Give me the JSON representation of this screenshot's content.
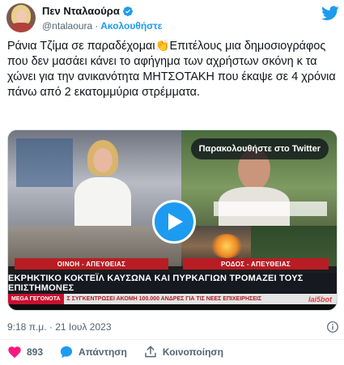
{
  "author": {
    "display_name": "Πεν Νταλαούρα",
    "handle": "@ntalaoura",
    "separator": "·",
    "follow_label": "Ακολουθήστε"
  },
  "tweet": {
    "text": "Ράνια Τζίμα σε παραδέχομαι👏Επιτέλους μια δημοσιογράφος που δεν μασάει κάνει το αφήγημα των αχρήστων σκόνη κ τα χώνει για την ανικανότητα ΜΗΤΣΟΤΑΚΗ που έκαψε σε 4 χρόνια πάνω από 2 εκατομμύρια στρέμματα.",
    "timestamp": "9:18 π.μ. · 21 Ιουλ 2023"
  },
  "media": {
    "watch_label": "Παρακολουθήστε στο Twitter",
    "location_left": "ΟΙΝΟΗ - ΑΠΕΥΘΕΙΑΣ",
    "location_right": "ΡΟΔΟΣ - ΑΠΕΥΘΕΙΑΣ",
    "headline": "ΕΚΡΗΚΤΙΚΟ ΚΟΚΤΕΪΛ ΚΑΥΣΩΝΑ ΚΑΙ ΠΥΡΚΑΓΙΩΝ ΤΡΟΜΑΖΕΙ ΤΟΥΣ ΕΠΙΣΤΗΜΟΝΕΣ",
    "ticker_brand": "MEGA ΓΕΓΟΝΟΤΑ",
    "ticker_text": "Σ ΣΥΓΚΕΝΤΡΩΣΕΙ ΑΚΟΜΗ 100.000 ΑΝΔΡΕΣ ΓΙΑ ΤΙΣ ΝΕΕΣ ΕΠΙΧΕΙΡΗΣΕΙΣ",
    "ticker_logo": "lai5bot"
  },
  "actions": {
    "likes": "893",
    "reply_label": "Απάντηση",
    "share_label": "Κοινοποίηση"
  },
  "colors": {
    "accent": "#1d9bf0",
    "like": "#f91880",
    "secondary_text": "#536471"
  },
  "icons": [
    "verified-badge-icon",
    "twitter-bird-icon",
    "play-icon",
    "info-icon",
    "heart-icon",
    "reply-icon",
    "share-icon"
  ]
}
